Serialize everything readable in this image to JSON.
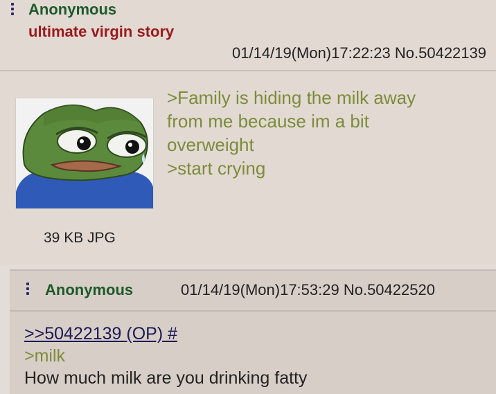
{
  "op": {
    "name": "Anonymous",
    "subject": "ultimate virgin story",
    "datetime_no": "01/14/19(Mon)17:22:23 No.50422139",
    "file_info": "39 KB JPG",
    "body_lines": [
      ">Family is hiding the milk away",
      "from me because im a bit",
      "overweight",
      ">start crying"
    ]
  },
  "reply": {
    "name": "Anonymous",
    "datetime_no": "01/14/19(Mon)17:53:29 No.50422520",
    "quote_link": ">>50422139 (OP) #",
    "greentext": ">milk",
    "text": "How much milk are you drinking fatty"
  },
  "colors": {
    "name_green": "#1c5a2a",
    "subject_red": "#9a1a1a",
    "greentext": "#7c8c3a",
    "link": "#1a1a55"
  },
  "icons": [
    "menu-dots-icon",
    "pepe-frog-image"
  ]
}
